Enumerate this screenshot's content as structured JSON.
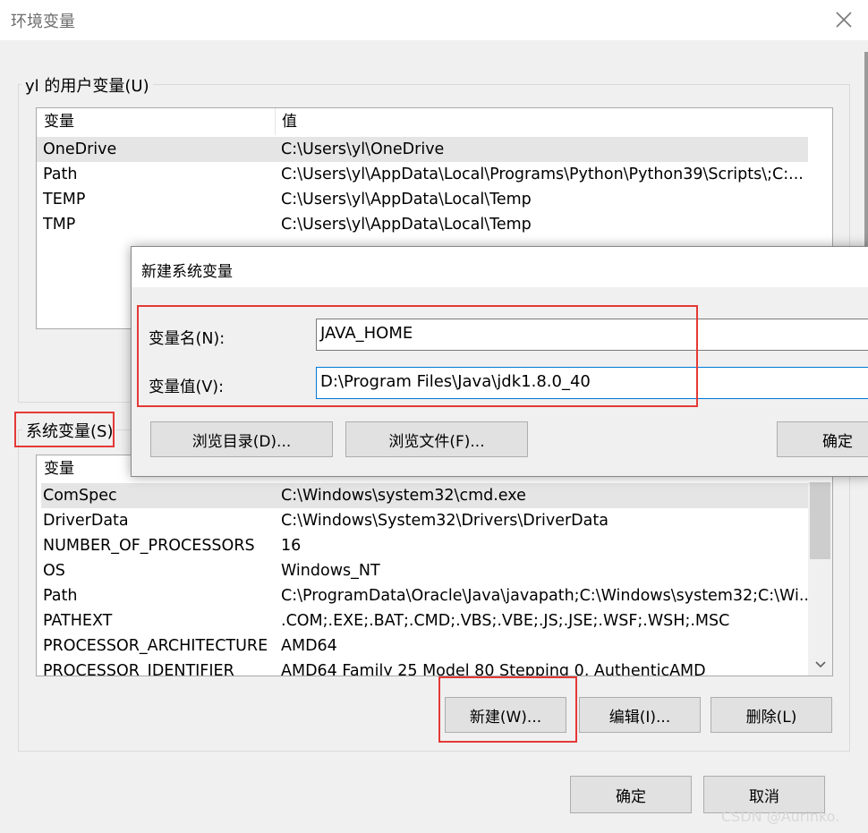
{
  "window": {
    "title": "环境变量",
    "close_icon": "close-icon"
  },
  "user_vars": {
    "group_title": "yl 的用户变量(U)",
    "columns": [
      "变量",
      "值"
    ],
    "rows": [
      {
        "name": "OneDrive",
        "value": "C:\\Users\\yl\\OneDrive"
      },
      {
        "name": "Path",
        "value": "C:\\Users\\yl\\AppData\\Local\\Programs\\Python\\Python39\\Scripts\\;C:..."
      },
      {
        "name": "TEMP",
        "value": "C:\\Users\\yl\\AppData\\Local\\Temp"
      },
      {
        "name": "TMP",
        "value": "C:\\Users\\yl\\AppData\\Local\\Temp"
      }
    ]
  },
  "system_vars": {
    "group_title": "系统变量(S)",
    "columns": [
      "变量"
    ],
    "rows": [
      {
        "name": "ComSpec",
        "value": "C:\\Windows\\system32\\cmd.exe"
      },
      {
        "name": "DriverData",
        "value": "C:\\Windows\\System32\\Drivers\\DriverData"
      },
      {
        "name": "NUMBER_OF_PROCESSORS",
        "value": "16"
      },
      {
        "name": "OS",
        "value": "Windows_NT"
      },
      {
        "name": "Path",
        "value": "C:\\ProgramData\\Oracle\\Java\\javapath;C:\\Windows\\system32;C:\\Wi..."
      },
      {
        "name": "PATHEXT",
        "value": ".COM;.EXE;.BAT;.CMD;.VBS;.VBE;.JS;.JSE;.WSF;.WSH;.MSC"
      },
      {
        "name": "PROCESSOR_ARCHITECTURE",
        "value": "AMD64"
      },
      {
        "name": "PROCESSOR_IDENTIFIER",
        "value": "AMD64 Family 25 Model 80 Stepping 0, AuthenticAMD"
      }
    ],
    "buttons": {
      "new": "新建(W)...",
      "edit": "编辑(I)...",
      "delete": "删除(L)"
    }
  },
  "footer": {
    "ok": "确定",
    "cancel": "取消"
  },
  "dialog": {
    "title": "新建系统变量",
    "name_label": "变量名(N):",
    "value_label": "变量值(V):",
    "name_value": "JAVA_HOME",
    "value_value": "D:\\Program Files\\Java\\jdk1.8.0_40",
    "browse_dir": "浏览目录(D)...",
    "browse_file": "浏览文件(F)...",
    "ok": "确定"
  },
  "watermark": "CSDN @Aurinko.",
  "colors": {
    "highlight_red": "#e53935",
    "selection_gray": "#e5e5e5",
    "focus_blue": "#0078d7"
  }
}
